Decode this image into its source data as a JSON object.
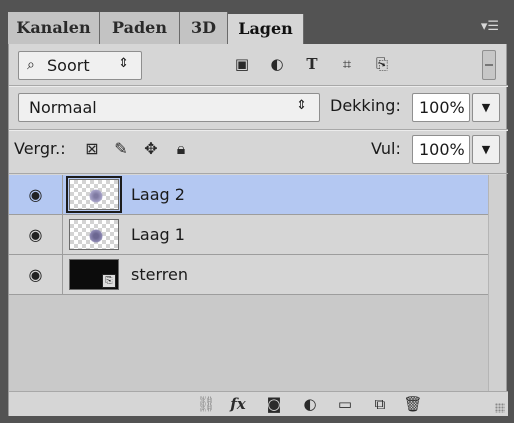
{
  "tabs": [
    {
      "label": "Kanalen"
    },
    {
      "label": "Paden"
    },
    {
      "label": "3D"
    },
    {
      "label": "Lagen"
    }
  ],
  "tab_menu_icon": "panel-menu-icon",
  "filter": {
    "kind_label": "Soort",
    "icons": [
      "pixel-layer-filter-icon",
      "adjustment-layer-filter-icon",
      "type-layer-filter-icon",
      "shape-layer-filter-icon",
      "smart-object-filter-icon"
    ]
  },
  "blend": {
    "mode": "Normaal",
    "opacity_label": "Dekking:",
    "opacity_value": "100%"
  },
  "lock": {
    "label": "Vergr.:",
    "icons": [
      "lock-transparent-pixels-icon",
      "lock-image-pixels-icon",
      "lock-position-icon",
      "lock-all-icon"
    ],
    "fill_label": "Vul:",
    "fill_value": "100%"
  },
  "layers": [
    {
      "name": "Laag 2",
      "selected": true
    },
    {
      "name": "Laag 1",
      "selected": false
    },
    {
      "name": "sterren",
      "selected": false
    }
  ],
  "bottom_icons": [
    "link-layers-icon",
    "layer-style-fx-icon",
    "add-mask-icon",
    "adjustment-layer-icon",
    "new-group-folder-icon",
    "new-layer-icon",
    "delete-trash-icon"
  ],
  "colors": {
    "selected_row": "#b4c8f2",
    "panel_bg": "#d6d6d6",
    "frame": "#535353"
  }
}
